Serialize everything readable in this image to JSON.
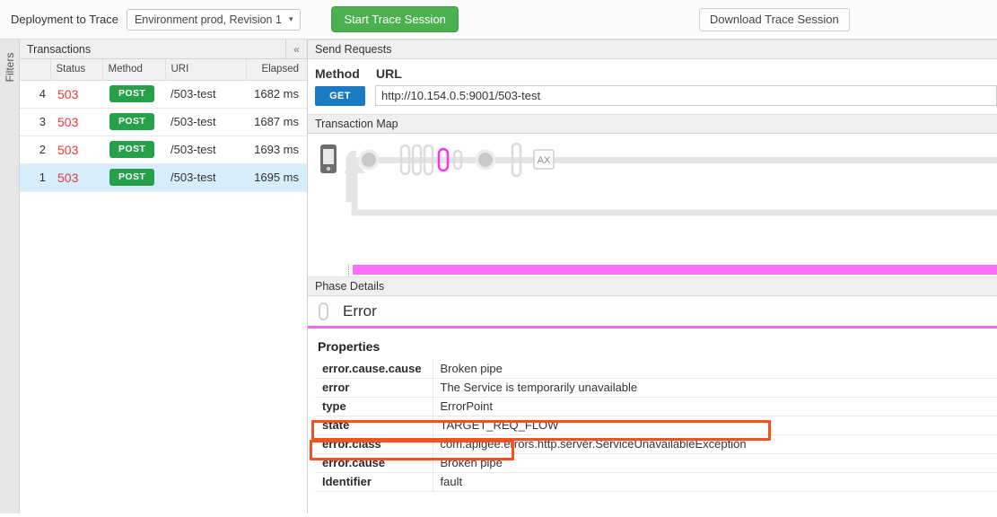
{
  "toolbar": {
    "deployment_label": "Deployment to Trace",
    "environment_value": "Environment prod, Revision 1",
    "caret": "▾",
    "start_button": "Start Trace Session",
    "download_button": "Download Trace Session"
  },
  "filters_rail": {
    "label": "Filters"
  },
  "transactions": {
    "title": "Transactions",
    "collapse_icon": "«",
    "columns": [
      "",
      "Status",
      "Method",
      "URI",
      "Elapsed"
    ],
    "rows": [
      {
        "index": "4",
        "status": "503",
        "method": "POST",
        "uri": "/503-test",
        "elapsed": "1682 ms",
        "selected": false
      },
      {
        "index": "3",
        "status": "503",
        "method": "POST",
        "uri": "/503-test",
        "elapsed": "1687 ms",
        "selected": false
      },
      {
        "index": "2",
        "status": "503",
        "method": "POST",
        "uri": "/503-test",
        "elapsed": "1693 ms",
        "selected": false
      },
      {
        "index": "1",
        "status": "503",
        "method": "POST",
        "uri": "/503-test",
        "elapsed": "1695 ms",
        "selected": true
      }
    ]
  },
  "send_requests": {
    "title": "Send Requests",
    "method_label": "Method",
    "url_label": "URL",
    "method_value": "GET",
    "url_value": "http://10.154.0.5:9001/503-test"
  },
  "transaction_map": {
    "title": "Transaction Map",
    "client_icon": "mobile-device-icon",
    "analytics_node_label": "AX",
    "highlight_color": "#ff2ff0",
    "timeline_color": "#fb6efb"
  },
  "phase_details": {
    "title": "Phase Details",
    "phase_name": "Error",
    "accent_color": "#f06af0"
  },
  "properties": {
    "title": "Properties",
    "rows": [
      {
        "key": "error.cause.cause",
        "value": "Broken pipe",
        "highlighted": false
      },
      {
        "key": "error",
        "value": "The Service is temporarily unavailable",
        "highlighted": false
      },
      {
        "key": "type",
        "value": "ErrorPoint",
        "highlighted": false
      },
      {
        "key": "state",
        "value": "TARGET_REQ_FLOW",
        "highlighted": false
      },
      {
        "key": "error.class",
        "value": "com.apigee.errors.http.server.ServiceUnavailableException",
        "highlighted": true
      },
      {
        "key": "error.cause",
        "value": "Broken pipe",
        "highlighted": true
      },
      {
        "key": "Identifier",
        "value": "fault",
        "highlighted": false
      }
    ],
    "annotation_color": "#f4511e"
  }
}
